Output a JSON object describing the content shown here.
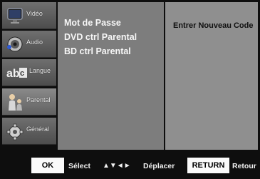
{
  "sidebar": {
    "items": [
      {
        "label": "Vidéo",
        "icon": "tv-icon"
      },
      {
        "label": "Audio",
        "icon": "speaker-icon"
      },
      {
        "label": "Langue",
        "icon": "language-icon"
      },
      {
        "label": "Parental",
        "icon": "parental-lock-icon"
      },
      {
        "label": "Général",
        "icon": "gear-icon"
      }
    ],
    "active_index": 3
  },
  "menu": {
    "items": [
      "Mot de Passe",
      "DVD ctrl Parental",
      "BD ctrl Parental"
    ]
  },
  "right_panel": {
    "title": "Entrer Nouveau Code"
  },
  "bottom_bar": {
    "ok_key": "OK",
    "ok_hint": "Sélect",
    "nav_arrows": "▲▼◄►",
    "nav_hint": "Déplacer",
    "return_key": "RETURN",
    "return_hint": "Retour"
  },
  "colors": {
    "background": "#0e0e0e",
    "menu_panel": "#7d7d7d",
    "right_panel": "#8f8f8f",
    "key_background": "#fafafa"
  }
}
